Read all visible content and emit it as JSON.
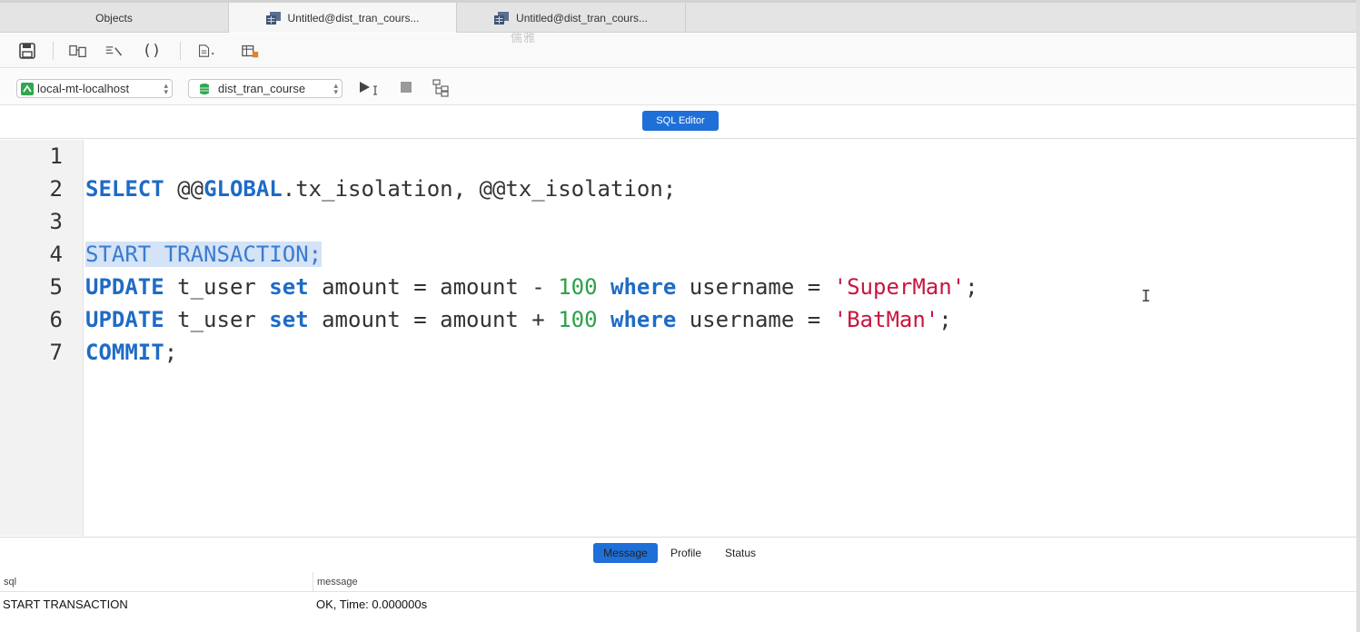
{
  "tabs": [
    {
      "label": "Objects",
      "active": false
    },
    {
      "label": "Untitled@dist_tran_cours...",
      "active": true
    },
    {
      "label": "Untitled@dist_tran_cours...",
      "active": false
    }
  ],
  "watermark": "儒雅",
  "connection": {
    "server": "local-mt-localhost",
    "database": "dist_tran_course"
  },
  "editor_mode_label": "SQL Editor",
  "code_lines": [
    {
      "num": "1"
    },
    {
      "num": "2"
    },
    {
      "num": "3"
    },
    {
      "num": "4"
    },
    {
      "num": "5"
    },
    {
      "num": "6"
    },
    {
      "num": "7"
    }
  ],
  "code": {
    "l2": {
      "kw1": "SELECT",
      "t1": " @@",
      "kw2": "GLOBAL",
      "t2": ".tx_isolation, @@tx_isolation;"
    },
    "l4": {
      "text": "START TRANSACTION;"
    },
    "l5": {
      "kw1": "UPDATE",
      "t1": " t_user ",
      "kw2": "set",
      "t2": " amount = amount - ",
      "n": "100",
      "t3": " ",
      "kw3": "where",
      "t4": " username = ",
      "s": "'SuperMan'",
      "t5": ";"
    },
    "l6": {
      "kw1": "UPDATE",
      "t1": " t_user ",
      "kw2": "set",
      "t2": " amount = amount + ",
      "n": "100",
      "t3": " ",
      "kw3": "where",
      "t4": " username = ",
      "s": "'BatMan'",
      "t5": ";"
    },
    "l7": {
      "kw1": "COMMIT",
      "t1": ";"
    }
  },
  "result_tabs": [
    {
      "label": "Message",
      "active": true
    },
    {
      "label": "Profile",
      "active": false
    },
    {
      "label": "Status",
      "active": false
    }
  ],
  "result_columns": [
    "sql",
    "message"
  ],
  "result_rows": [
    {
      "sql": "START TRANSACTION",
      "message": "OK, Time: 0.000000s"
    }
  ],
  "colors": {
    "keyword": "#1e6bc6",
    "number": "#2ca24a",
    "string": "#c8153f",
    "accent": "#1f6fd8"
  }
}
